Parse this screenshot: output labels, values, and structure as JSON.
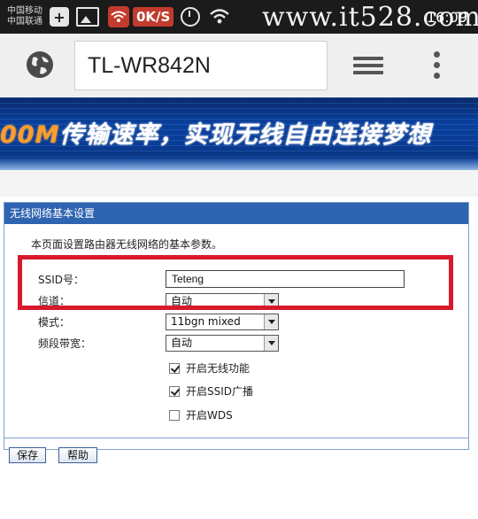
{
  "status_bar": {
    "carrier_top": "中国移动",
    "carrier_bottom": "中国联通",
    "net_speed": "0K/S",
    "watermark": "www.it528.com",
    "time": "16:09"
  },
  "browser": {
    "url": "TL-WR842N",
    "icons": [
      "globe-icon",
      "tabs-icon",
      "overflow-menu-icon"
    ]
  },
  "banner": {
    "speed_prefix": "00M",
    "slogan": "传输速率，实现无线自由连接梦想"
  },
  "panel": {
    "title": "无线网络基本设置",
    "description": "本页面设置路由器无线网络的基本参数。",
    "ssid_label": "SSID号：",
    "ssid_value": "Teteng",
    "channel_label": "信道：",
    "channel_value": "自动",
    "mode_label": "模式：",
    "mode_value": "11bgn mixed",
    "bandwidth_label": "频段带宽：",
    "bandwidth_value": "自动",
    "checkboxes": [
      {
        "label": "开启无线功能",
        "checked": true
      },
      {
        "label": "开启SSID广播",
        "checked": true
      },
      {
        "label": "开启WDS",
        "checked": false
      }
    ],
    "save_button": "保存",
    "help_button": "帮助"
  },
  "colors": {
    "panel_header": "#2f64b1",
    "highlight": "#d7192b",
    "banner_blue": "#0a3f9c",
    "banner_accent": "#ff9d2a"
  }
}
